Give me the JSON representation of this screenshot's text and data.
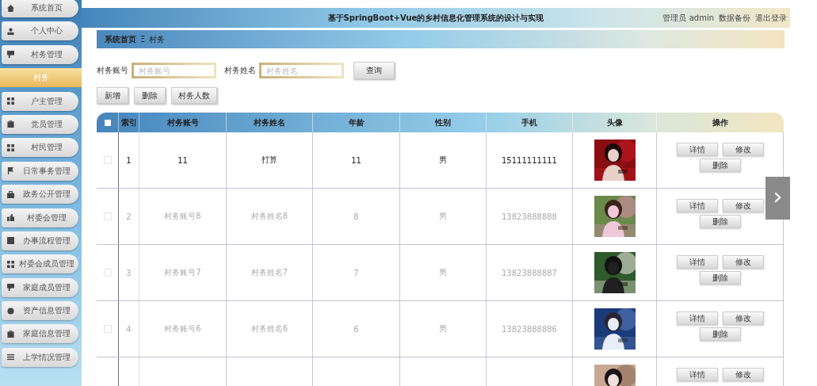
{
  "sidebar": {
    "items": [
      {
        "label": "系统首页",
        "selected": false
      },
      {
        "label": "个人中心",
        "selected": false
      },
      {
        "label": "村务管理",
        "selected": false
      },
      {
        "label": "村务",
        "selected": true
      },
      {
        "label": "户主管理",
        "selected": false
      },
      {
        "label": "党员管理",
        "selected": false
      },
      {
        "label": "村民管理",
        "selected": false
      },
      {
        "label": "日常事务管理",
        "selected": false
      },
      {
        "label": "政务公开管理",
        "selected": false
      },
      {
        "label": "村委会管理",
        "selected": false
      },
      {
        "label": "办事流程管理",
        "selected": false
      },
      {
        "label": "村委会成员管理",
        "selected": false
      },
      {
        "label": "家庭成员管理",
        "selected": false
      },
      {
        "label": "资产信息管理",
        "selected": false
      },
      {
        "label": "家庭信息管理",
        "selected": false
      },
      {
        "label": "上学情况管理",
        "selected": false
      }
    ]
  },
  "header": {
    "title": "基于SpringBoot+Vue的乡村信息化管理系统的设计与实现",
    "user": "管理员 admin",
    "links": [
      "数据备份",
      "退出登录"
    ]
  },
  "breadcrumb": {
    "items": [
      "系统首页",
      "村务"
    ],
    "separator": "Ξ"
  },
  "search": {
    "fields": [
      {
        "label": "村务账号",
        "placeholder": "村务账号"
      },
      {
        "label": "村务姓名",
        "placeholder": "村务姓名"
      }
    ],
    "button": "查询"
  },
  "actions": [
    "新增",
    "删除",
    "村务人数"
  ],
  "table": {
    "select_all_checked": false,
    "columns": [
      "索引",
      "村务账号",
      "村务姓名",
      "年龄",
      "性别",
      "手机",
      "头像",
      "操作"
    ],
    "rows": [
      {
        "selected": true,
        "checked": false,
        "cells": [
          "1",
          "11",
          "打算",
          "11",
          "男",
          "15111111111"
        ],
        "kind": "picture",
        "buttons": [
          "详情",
          "修改",
          "删除"
        ]
      },
      {
        "selected": false,
        "checked": false,
        "cells": [
          "2",
          "村务账号8",
          "村务姓名8",
          "8",
          "男",
          "13823888888"
        ],
        "kind": "picture",
        "buttons": [
          "详情",
          "修改",
          "删除"
        ]
      },
      {
        "selected": false,
        "checked": false,
        "cells": [
          "3",
          "村务账号7",
          "村务姓名7",
          "7",
          "男",
          "13823888887"
        ],
        "kind": "picture",
        "buttons": [
          "详情",
          "修改",
          "删除"
        ]
      },
      {
        "selected": false,
        "checked": false,
        "cells": [
          "4",
          "村务账号6",
          "村务姓名6",
          "6",
          "男",
          "13823888886"
        ],
        "kind": "picture",
        "buttons": [
          "详情",
          "修改",
          "删除"
        ]
      },
      {
        "kind": "picture",
        "buttons": [
          "详情",
          "修改"
        ]
      }
    ]
  },
  "pager_arrow": "›"
}
